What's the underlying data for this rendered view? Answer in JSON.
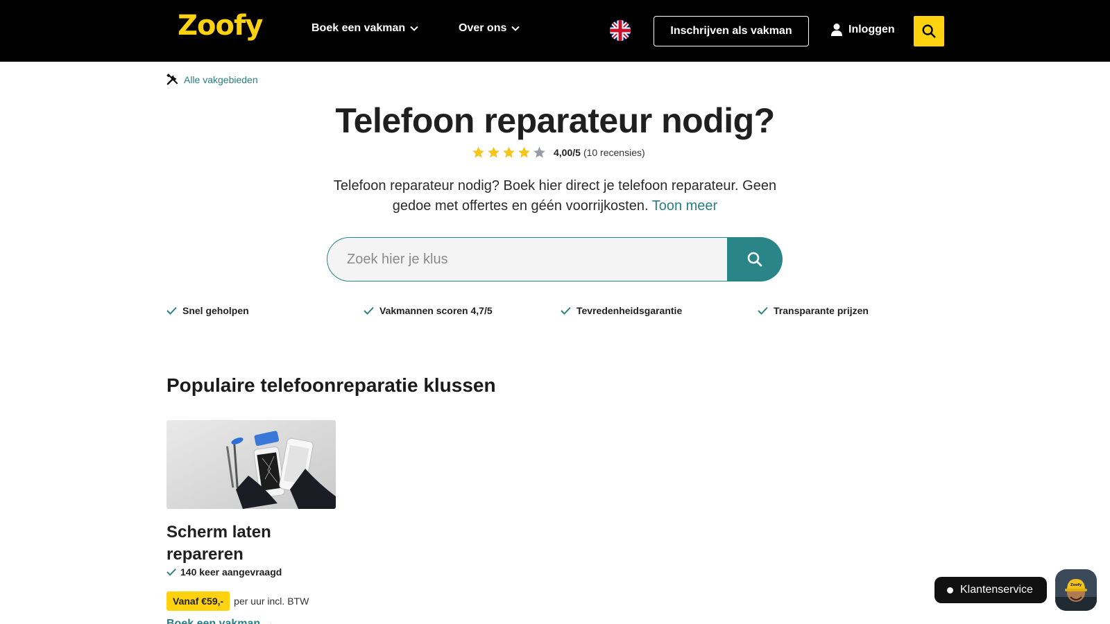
{
  "header": {
    "logo": "Zoofy",
    "nav": [
      {
        "label": "Boek een vakman"
      },
      {
        "label": "Over ons"
      }
    ],
    "signup_label": "Inschrijven als vakman",
    "login_label": "Inloggen"
  },
  "breadcrumb": {
    "label": "Alle vakgebieden"
  },
  "hero": {
    "title": "Telefoon reparateur nodig?",
    "rating_value": "4,00/5",
    "rating_count": "(10 recensies)",
    "stars_filled": 4,
    "stars_total": 5,
    "intro": "Telefoon reparateur nodig? Boek hier direct je telefoon reparateur. Geen gedoe met offertes en géén voorrijkosten.",
    "show_more": "Toon meer"
  },
  "search": {
    "placeholder": "Zoek hier je klus"
  },
  "usps": [
    {
      "label": "Snel geholpen"
    },
    {
      "label": "Vakmannen scoren 4,7/5"
    },
    {
      "label": "Tevredenheidsgarantie"
    },
    {
      "label": "Transparante prijzen"
    }
  ],
  "section": {
    "title": "Populaire telefoonreparatie klussen"
  },
  "cards": [
    {
      "title": "Scherm laten repareren",
      "requested": "140 keer aangevraagd",
      "price": "Vanaf €59,-",
      "price_note": "per uur incl. BTW",
      "link": "Boek een vakman →"
    }
  ],
  "support": {
    "label": "Klantenservice",
    "avatar_badge": "Zoofy"
  },
  "colors": {
    "brand_yellow": "#ffd20f",
    "teal": "#2a8588",
    "header_bg": "#000000"
  }
}
